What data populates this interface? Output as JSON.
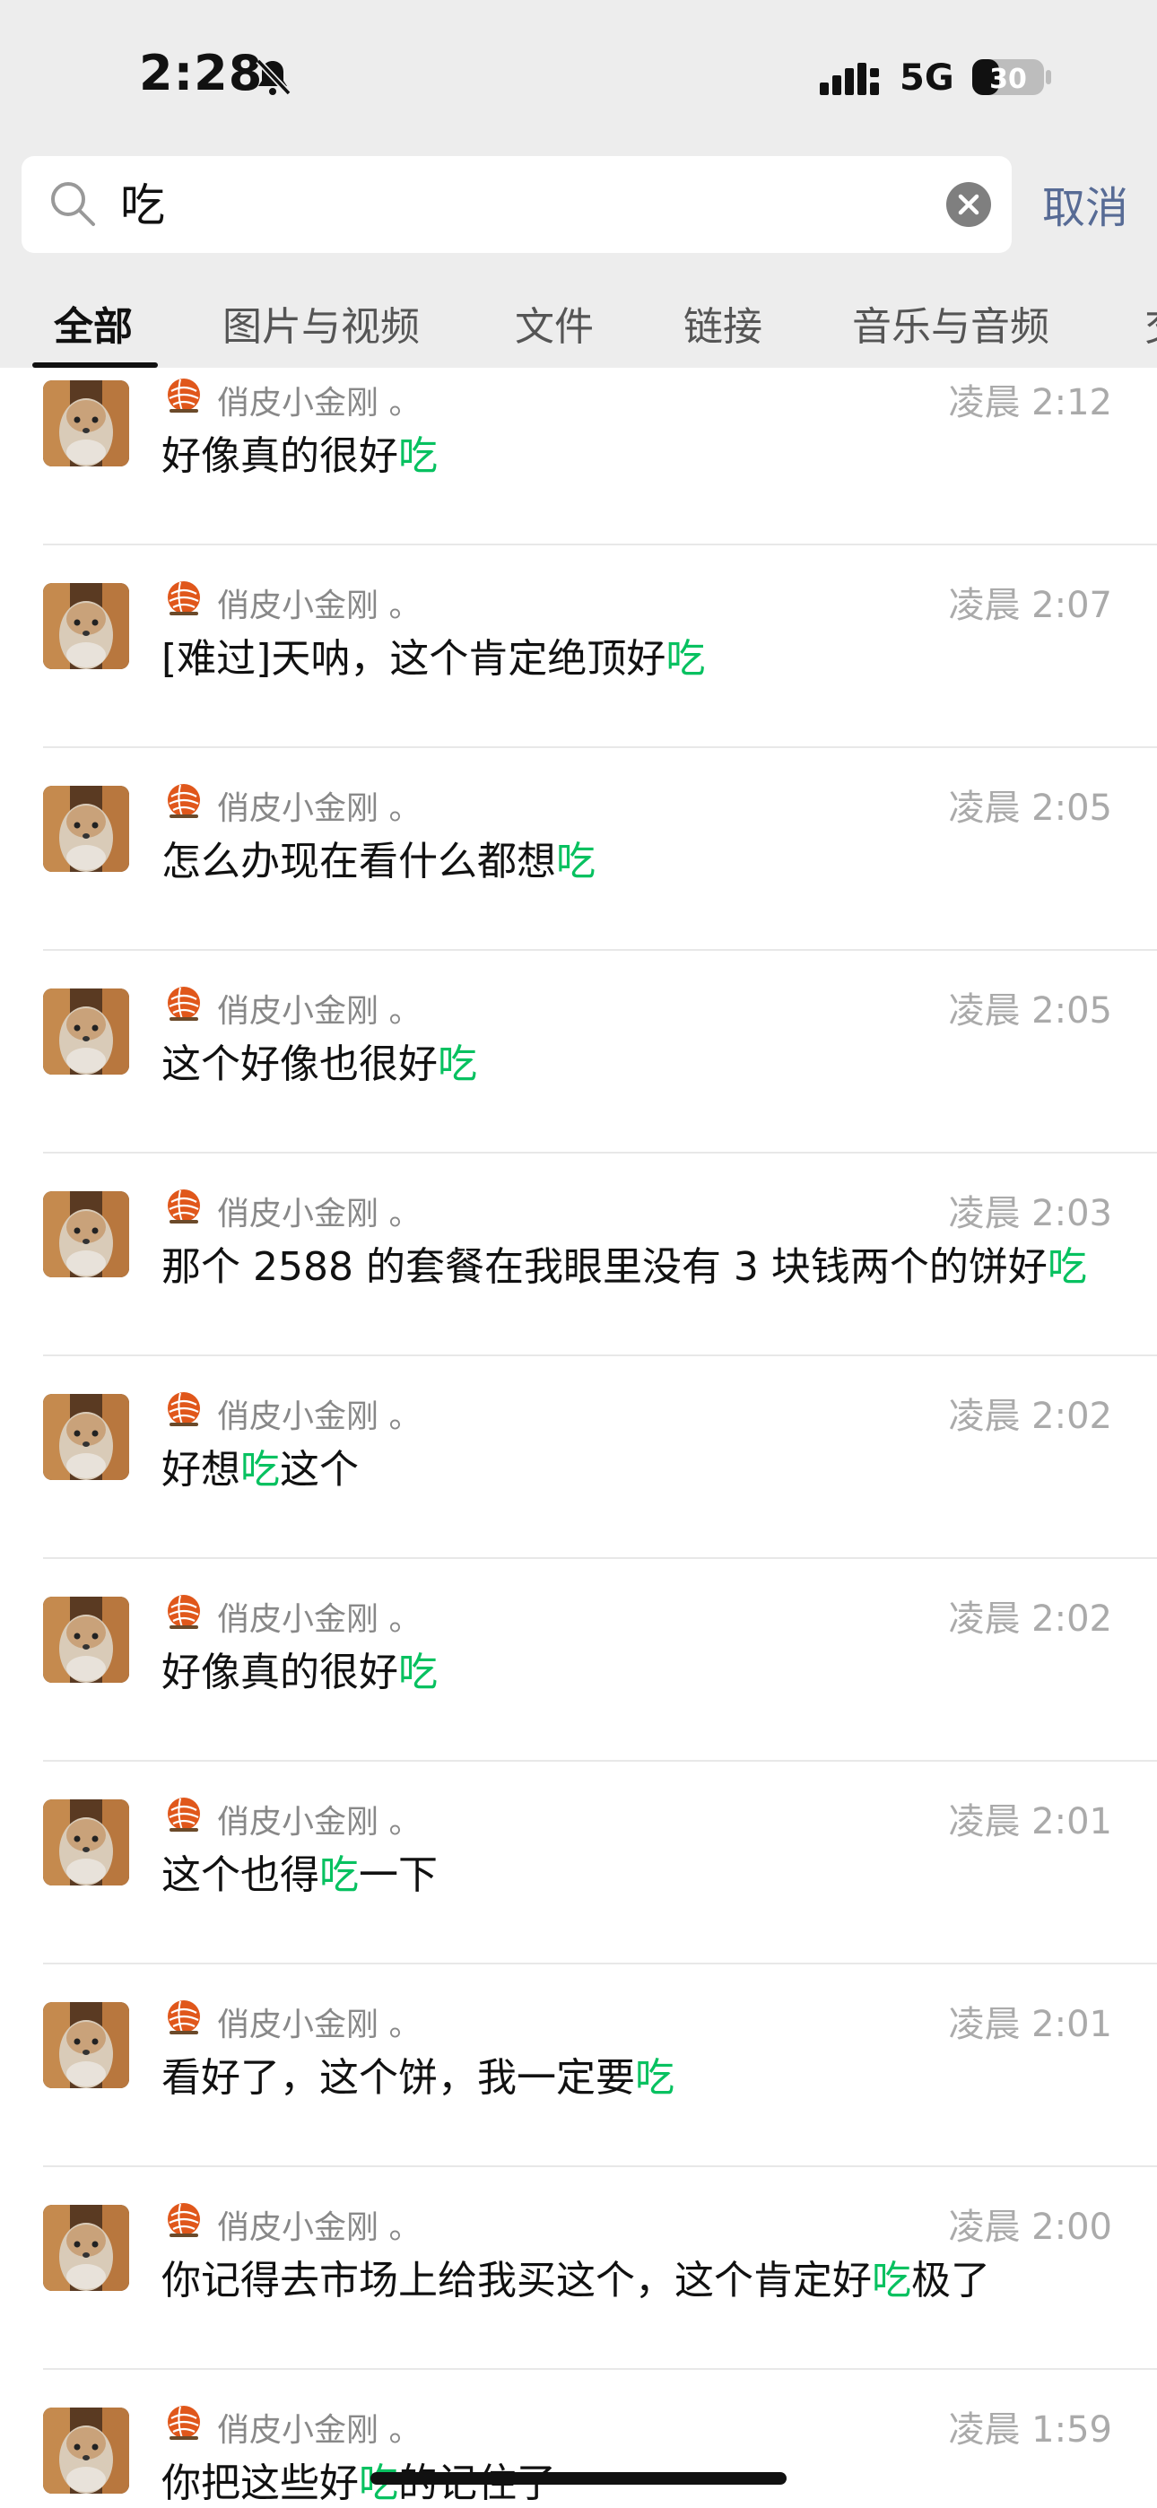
{
  "status_bar": {
    "time": "2:28",
    "network": "5G",
    "battery": "30"
  },
  "search": {
    "query": "吃",
    "cancel_label": "取消"
  },
  "tabs": [
    {
      "label": "全部",
      "active": true
    },
    {
      "label": "图片与视频",
      "active": false
    },
    {
      "label": "文件",
      "active": false
    },
    {
      "label": "链接",
      "active": false
    },
    {
      "label": "音乐与音频",
      "active": false
    },
    {
      "label": "交",
      "active": false
    }
  ],
  "results": [
    {
      "sender": "俏皮小金刚 。",
      "time": "凌晨 2:12",
      "pre": "好像真的很好",
      "hl": "吃",
      "post": ""
    },
    {
      "sender": "俏皮小金刚 。",
      "time": "凌晨 2:07",
      "pre": "[难过]天呐，这个肯定绝顶好",
      "hl": "吃",
      "post": ""
    },
    {
      "sender": "俏皮小金刚 。",
      "time": "凌晨 2:05",
      "pre": "怎么办现在看什么都想",
      "hl": "吃",
      "post": ""
    },
    {
      "sender": "俏皮小金刚 。",
      "time": "凌晨 2:05",
      "pre": "这个好像也很好",
      "hl": "吃",
      "post": ""
    },
    {
      "sender": "俏皮小金刚 。",
      "time": "凌晨 2:03",
      "pre": "那个 2588 的套餐在我眼里没有 3 块钱两个的饼好",
      "hl": "吃",
      "post": ""
    },
    {
      "sender": "俏皮小金刚 。",
      "time": "凌晨 2:02",
      "pre": "好想",
      "hl": "吃",
      "post": "这个"
    },
    {
      "sender": "俏皮小金刚 。",
      "time": "凌晨 2:02",
      "pre": "好像真的很好",
      "hl": "吃",
      "post": ""
    },
    {
      "sender": "俏皮小金刚 。",
      "time": "凌晨 2:01",
      "pre": "这个也得",
      "hl": "吃",
      "post": "一下"
    },
    {
      "sender": "俏皮小金刚 。",
      "time": "凌晨 2:01",
      "pre": "看好了，这个饼，我一定要",
      "hl": "吃",
      "post": ""
    },
    {
      "sender": "俏皮小金刚 。",
      "time": "凌晨 2:00",
      "pre": "你记得去市场上给我买这个，这个肯定好",
      "hl": "吃",
      "post": "极了"
    },
    {
      "sender": "俏皮小金刚 。",
      "time": "凌晨 1:59",
      "pre": "你把这些好",
      "hl": "吃",
      "post": "的记住了"
    }
  ],
  "colors": {
    "highlight": "#07c160",
    "link": "#576b95"
  }
}
